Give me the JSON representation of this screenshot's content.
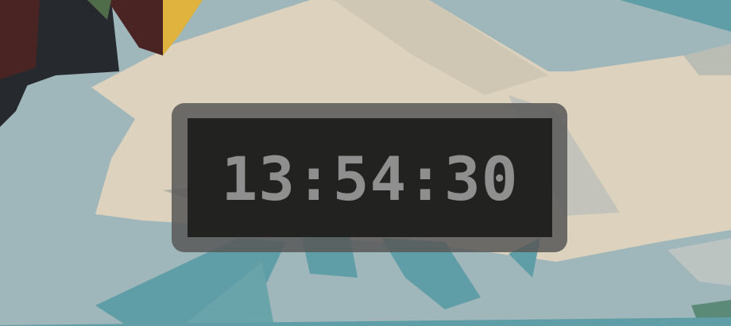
{
  "clock": {
    "time": "13:54:30"
  },
  "colors": {
    "sky": "#9fb6bb",
    "cream": "#dcd2bd",
    "teal": "#5f9ea6",
    "dark": "#26292e",
    "maroon": "#4a2323",
    "mustard": "#e0b33e",
    "frame": "#585858",
    "face": "#222220",
    "digits": "#8f8f8f"
  }
}
